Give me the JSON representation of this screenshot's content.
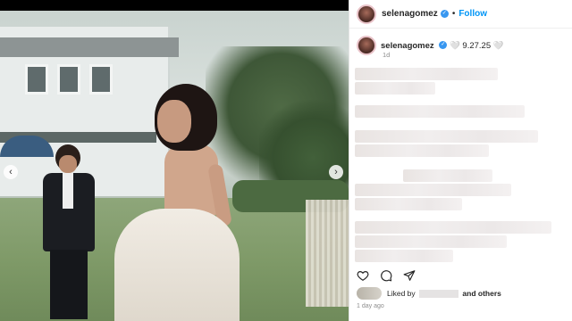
{
  "header": {
    "username": "selenagomez",
    "follow_label": "Follow",
    "separator": "•"
  },
  "caption": {
    "username": "selenagomez",
    "text": "🤍 9.27.25 🤍",
    "time": "1d"
  },
  "likes": {
    "prefix": "Liked by",
    "suffix": "and others"
  },
  "post_age": "1 day ago",
  "media": {
    "prev_glyph": "‹",
    "next_glyph": "›"
  },
  "icons": {
    "like": "heart-icon",
    "comment": "comment-icon",
    "share": "share-icon"
  },
  "colors": {
    "accent": "#0095f6",
    "verified": "#3897f0",
    "text": "#262626",
    "muted": "#8e8e8e"
  }
}
